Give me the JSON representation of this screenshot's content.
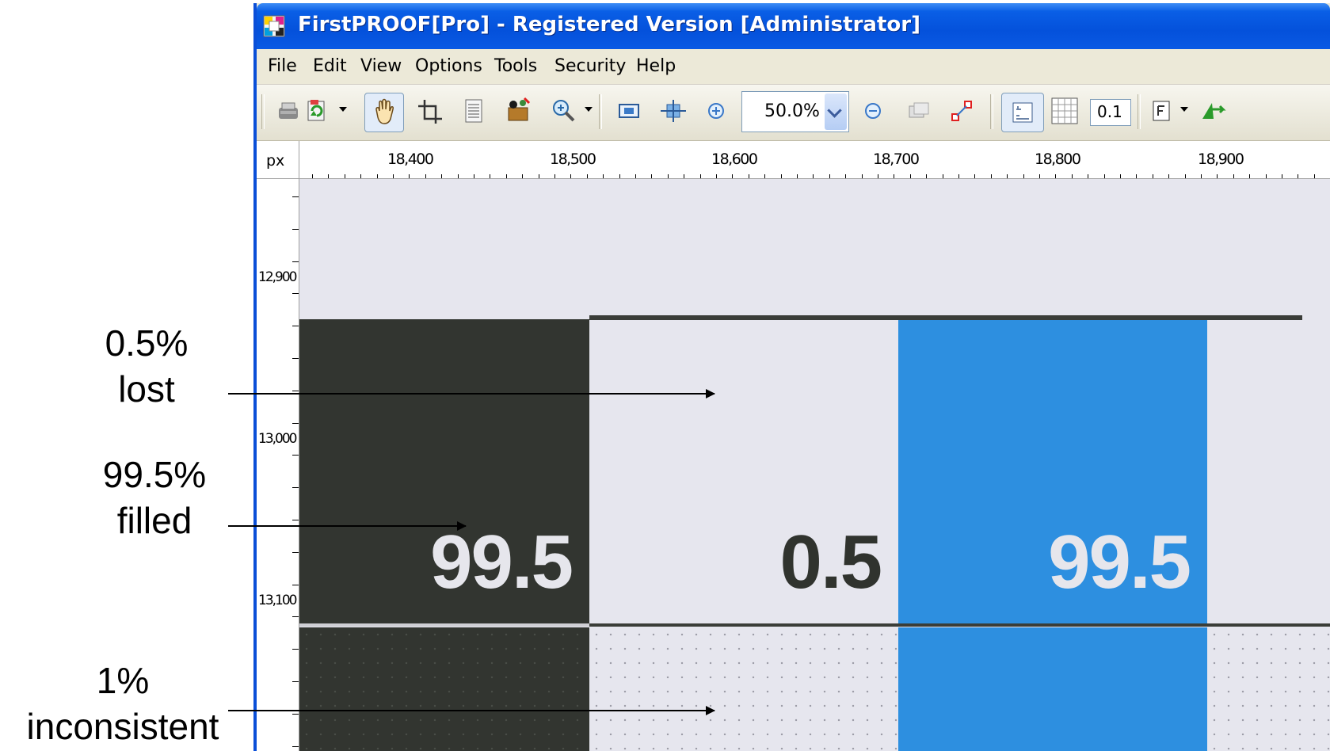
{
  "annotations": {
    "lost_line1": "0.5%",
    "lost_line2": "lost",
    "filled_line1": "99.5%",
    "filled_line2": "filled",
    "inconsistent_line1": "1%",
    "inconsistent_line2": "inconsistent"
  },
  "window": {
    "title": "FirstPROOF[Pro] - Registered Version [Administrator]"
  },
  "menu": {
    "items": [
      "File",
      "Edit",
      "View",
      "Options",
      "Tools",
      "Security",
      "Help"
    ]
  },
  "toolbar": {
    "zoom_value": "50.0%",
    "grid_value": "0.1",
    "icons": [
      "print-icon",
      "refresh-icon",
      "hand-pan-icon",
      "crop-icon",
      "page-icon",
      "magic-icon",
      "zoom-tool-icon",
      "fit-image-icon",
      "fit-width-icon",
      "zoom-in-icon",
      "zoom-out-icon",
      "compare-icon",
      "expand-icon",
      "ruler-icon",
      "grid-icon",
      "font-icon",
      "flip-icon"
    ]
  },
  "ruler": {
    "unit": "px",
    "top_labels": [
      "18,400",
      "18,500",
      "18,600",
      "18,700",
      "18,800",
      "18,900"
    ],
    "left_labels": [
      "12,900",
      "13,000",
      "13,100"
    ]
  },
  "canvas": {
    "patches": [
      {
        "label": "99.5",
        "color": "#323530",
        "text_color": "#e6e6ec"
      },
      {
        "label": "0.5",
        "color": "#e6e6ee",
        "text_color": "#30332e"
      },
      {
        "label": "99.5",
        "color": "#2d8fe0",
        "text_color": "#e6e6ec"
      }
    ]
  }
}
